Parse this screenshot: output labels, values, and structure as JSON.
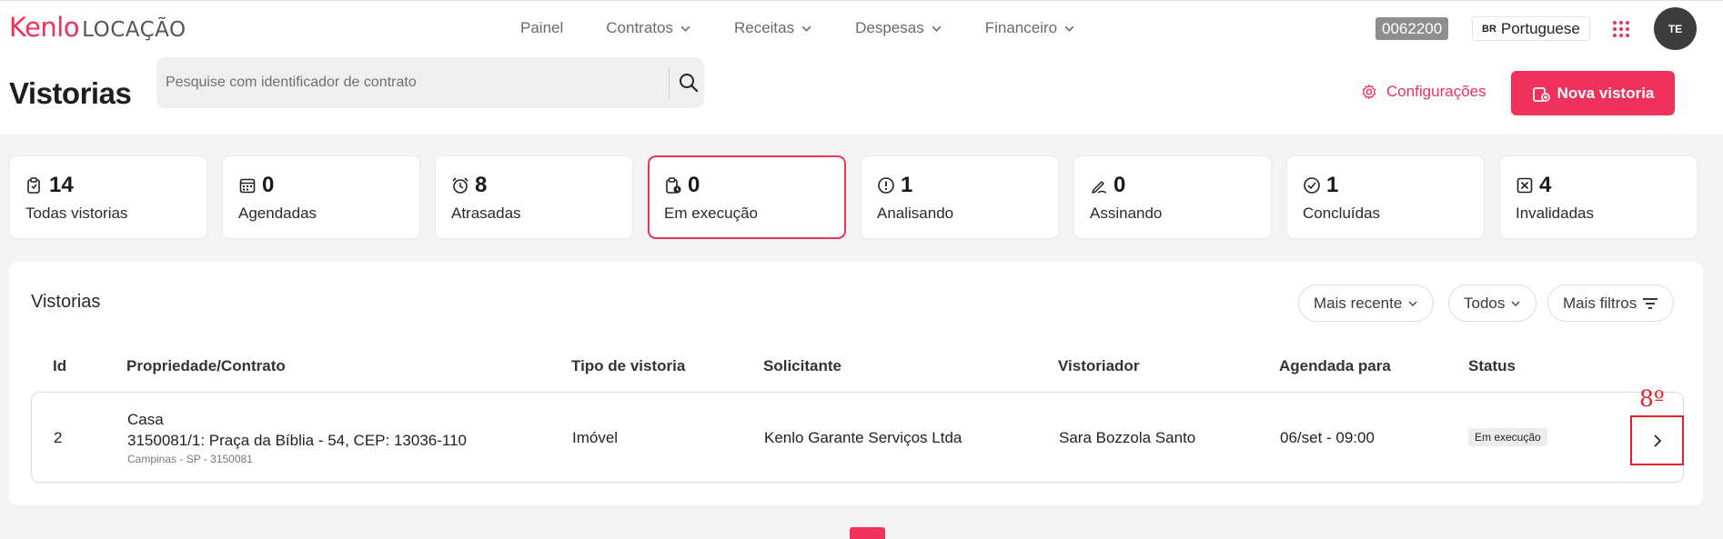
{
  "brand": {
    "name_a": "Kenlo",
    "name_b": "LOCAÇÃO",
    "accent_color": "#f0315a"
  },
  "nav": {
    "items": [
      {
        "label": "Painel",
        "has_dropdown": false
      },
      {
        "label": "Contratos",
        "has_dropdown": true
      },
      {
        "label": "Receitas",
        "has_dropdown": true
      },
      {
        "label": "Despesas",
        "has_dropdown": true
      },
      {
        "label": "Financeiro",
        "has_dropdown": true
      }
    ]
  },
  "header": {
    "account_code": "0062200",
    "language_flag": "BR",
    "language": "Portuguese",
    "apps_icon": "apps-grid-icon",
    "avatar_initials": "TE"
  },
  "page": {
    "title": "Vistorias",
    "search_placeholder": "Pesquise com identificador de contrato",
    "search_icon": "search-icon",
    "config_label": "Configurações",
    "new_button_label": "Nova vistoria"
  },
  "stats": [
    {
      "count": "14",
      "label": "Todas vistorias",
      "icon": "clipboard-icon",
      "active": false
    },
    {
      "count": "0",
      "label": "Agendadas",
      "icon": "calendar-icon",
      "active": false
    },
    {
      "count": "8",
      "label": "Atrasadas",
      "icon": "alarm-clock-icon",
      "active": false
    },
    {
      "count": "0",
      "label": "Em execução",
      "icon": "clipboard-clock-icon",
      "active": true
    },
    {
      "count": "1",
      "label": "Analisando",
      "icon": "alert-circle-icon",
      "active": false
    },
    {
      "count": "0",
      "label": "Assinando",
      "icon": "signature-pen-icon",
      "active": false
    },
    {
      "count": "1",
      "label": "Concluídas",
      "icon": "check-circle-icon",
      "active": false
    },
    {
      "count": "4",
      "label": "Invalidadas",
      "icon": "x-square-icon",
      "active": false
    }
  ],
  "list": {
    "title": "Vistorias",
    "filters": {
      "sort": "Mais recente",
      "scope": "Todos",
      "more": "Mais filtros"
    },
    "columns": [
      "Id",
      "Propriedade/Contrato",
      "Tipo de vistoria",
      "Solicitante",
      "Vistoriador",
      "Agendada para",
      "Status"
    ],
    "rows": [
      {
        "id": "2",
        "property_type": "Casa",
        "contract_address": "3150081/1: Praça da Bíblia - 54, CEP: 13036-110",
        "location": "Campinas - SP - 3150081",
        "inspection_type": "Imóvel",
        "requester": "Kenlo Garante Serviços Ltda",
        "inspector": "Sara Bozzola Santo",
        "scheduled": "06/set - 09:00",
        "status": "Em execução",
        "order_label": "8º"
      }
    ]
  }
}
